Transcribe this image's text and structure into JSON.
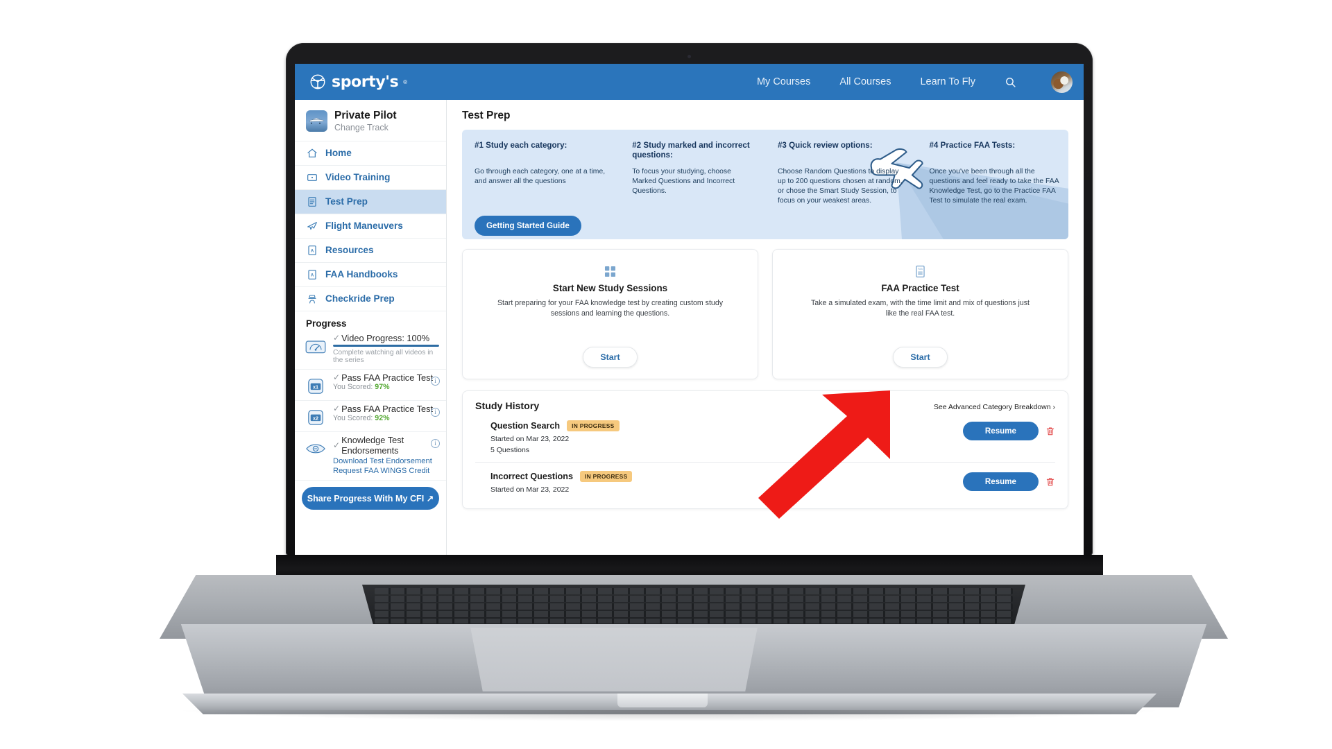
{
  "brand": {
    "name": "sporty's",
    "registered": "®"
  },
  "topnav": {
    "items": [
      {
        "label": "My Courses"
      },
      {
        "label": "All Courses"
      },
      {
        "label": "Learn To Fly"
      }
    ],
    "search_icon": "search-icon",
    "avatar_label": "User avatar"
  },
  "sidebar": {
    "course": {
      "title": "Private Pilot",
      "change_track": "Change Track"
    },
    "items": [
      {
        "label": "Home",
        "icon": "home-icon",
        "active": false
      },
      {
        "label": "Video Training",
        "icon": "video-icon",
        "active": false
      },
      {
        "label": "Test Prep",
        "icon": "document-list-icon",
        "active": true
      },
      {
        "label": "Flight Maneuvers",
        "icon": "airplane-icon",
        "active": false
      },
      {
        "label": "Resources",
        "icon": "pdf-icon",
        "active": false
      },
      {
        "label": "FAA Handbooks",
        "icon": "pdf-icon",
        "active": false
      },
      {
        "label": "Checkride Prep",
        "icon": "pilot-cap-icon",
        "active": false
      }
    ],
    "progress": {
      "title": "Progress",
      "rows": [
        {
          "label": "Video Progress: 100%",
          "note": "Complete watching all videos in the series",
          "bar_percent": 100,
          "icon": "gauge-icon",
          "has_info": false
        },
        {
          "label": "Pass FAA Practice Test",
          "score_prefix": "You Scored:",
          "score": "97%",
          "icon": "x1-badge-icon",
          "has_info": true
        },
        {
          "label": "Pass FAA Practice Test",
          "score_prefix": "You Scored:",
          "score": "92%",
          "icon": "x2-badge-icon",
          "has_info": true
        },
        {
          "label": "Knowledge Test Endorsements",
          "links": [
            "Download Test Endorsement",
            "Request FAA WINGS Credit"
          ],
          "icon": "wings-badge-icon",
          "has_info": true
        }
      ],
      "cfi_button": "Share Progress With My CFI ↗"
    }
  },
  "main": {
    "page_title": "Test Prep",
    "banner": {
      "columns": [
        {
          "heading": "#1 Study each category:",
          "body": "Go through each category, one at a time, and answer all the questions"
        },
        {
          "heading": "#2 Study marked and incorrect questions:",
          "body": "To focus your studying, choose Marked Questions and Incorrect Questions."
        },
        {
          "heading": "#3 Quick review options:",
          "body": "Choose Random Questions to display up to 200 questions chosen at random, or chose the Smart Study Session, to focus on your weakest areas."
        },
        {
          "heading": "#4 Practice FAA Tests:",
          "body": "Once you've been through all the questions and feel ready to take the FAA Knowledge Test, go to the Practice FAA Test to simulate the real exam."
        }
      ],
      "button": "Getting Started Guide",
      "art_icon": "airplane-illustration"
    },
    "cards": [
      {
        "icon": "grid-squares-icon",
        "title": "Start New Study Sessions",
        "desc": "Start preparing for your FAA knowledge test by creating custom study sessions and learning the questions.",
        "button": "Start"
      },
      {
        "icon": "faa-document-icon",
        "title": "FAA Practice Test",
        "desc": "Take a simulated exam, with the time limit and mix of questions just like the real FAA test.",
        "button": "Start"
      }
    ],
    "history": {
      "title": "Study History",
      "advanced_link": "See Advanced Category Breakdown ›",
      "rows": [
        {
          "name": "Question Search",
          "status": "IN PROGRESS",
          "started": "Started on Mar 23, 2022",
          "count": "5 Questions",
          "action": "Resume",
          "delete_icon": "trash-icon"
        },
        {
          "name": "Incorrect Questions",
          "status": "IN PROGRESS",
          "started": "Started on Mar 23, 2022",
          "count": "",
          "action": "Resume",
          "delete_icon": "trash-icon"
        }
      ]
    }
  },
  "annotation": {
    "arrow_color": "#EE1B17",
    "arrow_name": "red-pointer-arrow"
  },
  "colors": {
    "brand_blue": "#2B75BB",
    "banner_blue": "#D9E7F7",
    "active_nav": "#C9DCF0",
    "badge_amber": "#F6C97E",
    "score_green": "#53A832",
    "danger_red": "#E03B3B"
  }
}
